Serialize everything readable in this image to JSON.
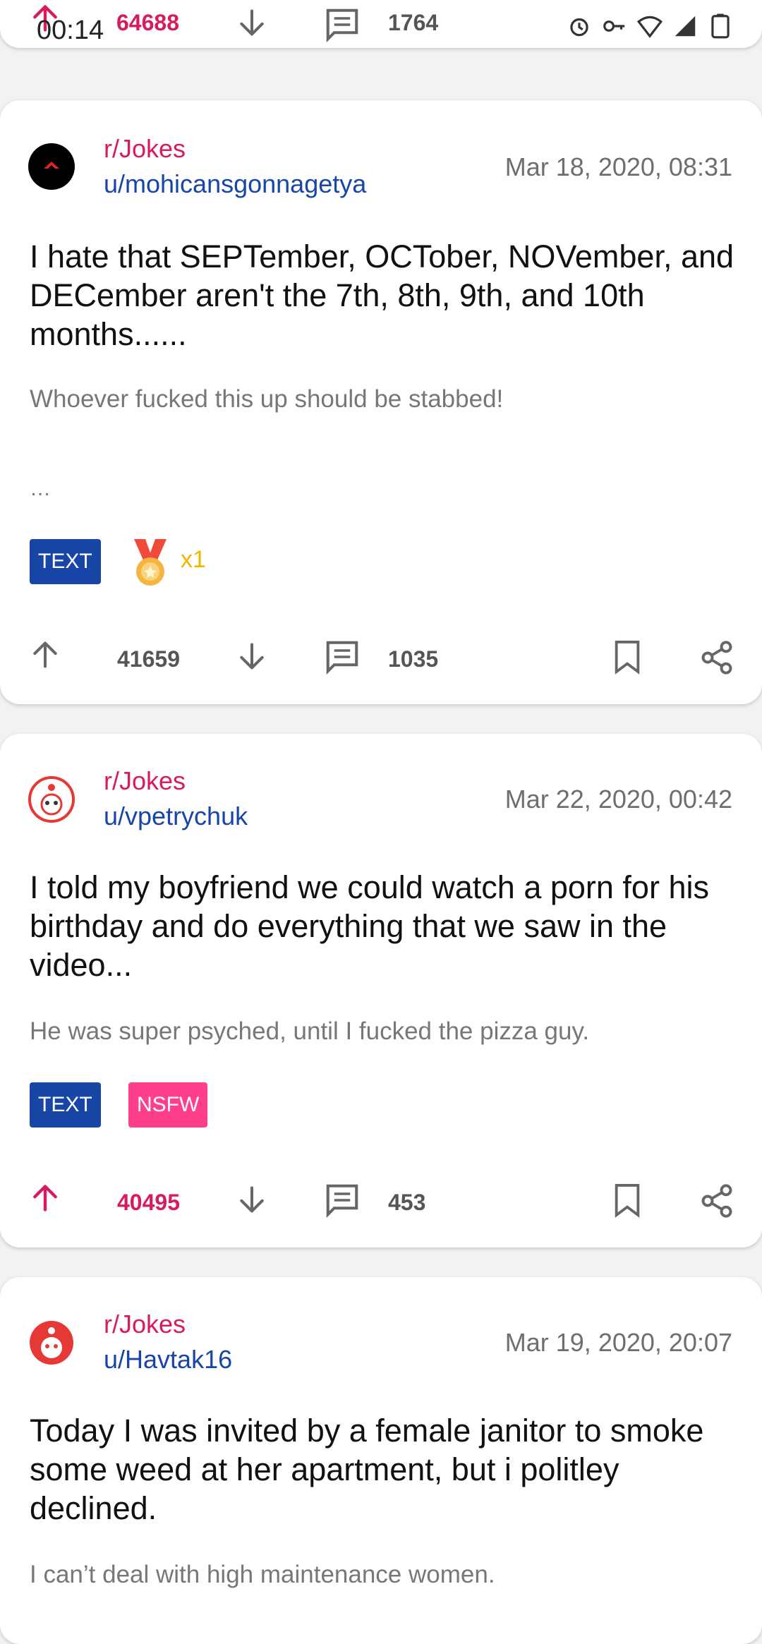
{
  "status": {
    "time": "00:14"
  },
  "prev_post": {
    "upvotes": "64688",
    "comments": "1764"
  },
  "posts": [
    {
      "subreddit": "r/Jokes",
      "user": "u/mohicansgonnagetya",
      "date": "Mar 18, 2020, 08:31",
      "title": "I hate that SEPTember, OCTober, NOVember, and DECember aren't the 7th, 8th, 9th, and 10th months......",
      "body": "Whoever fucked this up should be stabbed!",
      "more": "…",
      "tags": [
        "TEXT"
      ],
      "award_count": "x1",
      "upvotes": "41659",
      "comments": "1035"
    },
    {
      "subreddit": "r/Jokes",
      "user": "u/vpetrychuk",
      "date": "Mar 22, 2020, 00:42",
      "title": "I told my boyfriend we could watch a porn for his birthday and do everything that we saw in the video...",
      "body": "He was super psyched, until I fucked the pizza guy.",
      "tags": [
        "TEXT",
        "NSFW"
      ],
      "upvotes": "40495",
      "comments": "453"
    },
    {
      "subreddit": "r/Jokes",
      "user": "u/Havtak16",
      "date": "Mar 19, 2020, 20:07",
      "title": "Today I was invited by a female janitor to smoke some weed at her apartment, but i politley declined.",
      "body": "I can’t deal with high maintenance women."
    }
  ],
  "colors": {
    "subreddit": "#d81b60",
    "user": "#1846a6",
    "upvoted": "#d81b60",
    "tag_text": "#1846a6",
    "tag_nsfw": "#ff3f8c"
  }
}
